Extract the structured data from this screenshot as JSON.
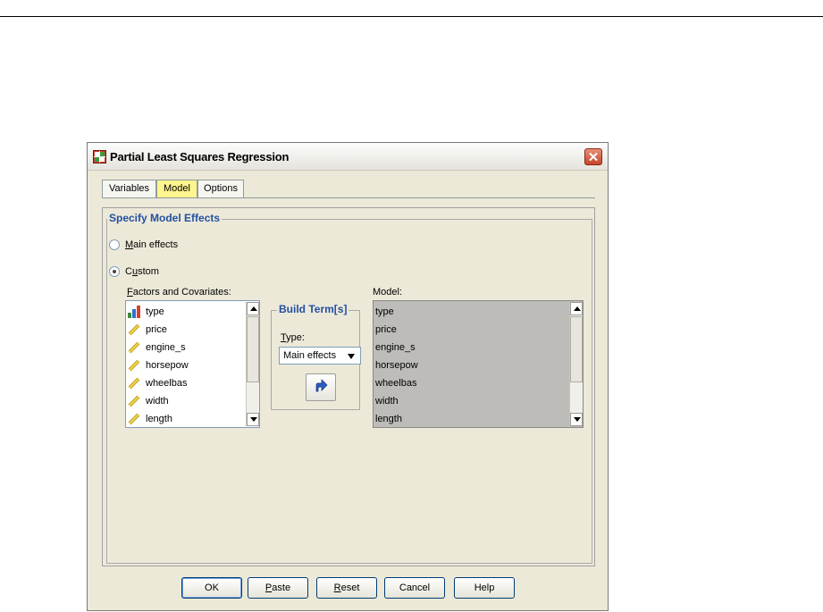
{
  "dialog": {
    "title": "Partial Least Squares Regression"
  },
  "tabs": [
    {
      "label": "Variables"
    },
    {
      "label": "Model"
    },
    {
      "label": "Options"
    }
  ],
  "model_effects": {
    "group_title": "Specify Model Effects",
    "main_effects_first": "M",
    "main_effects_rest": "ain effects",
    "custom_first": "C",
    "custom_underlined": "u",
    "custom_rest": "stom",
    "selected": "Custom"
  },
  "factors": {
    "label_first": "F",
    "label_rest": "actors and Covariates:",
    "items": [
      {
        "name": "type",
        "icon": "nominal-bar-icon"
      },
      {
        "name": "price",
        "icon": "scale-ruler-icon"
      },
      {
        "name": "engine_s",
        "icon": "scale-ruler-icon"
      },
      {
        "name": "horsepow",
        "icon": "scale-ruler-icon"
      },
      {
        "name": "wheelbas",
        "icon": "scale-ruler-icon"
      },
      {
        "name": "width",
        "icon": "scale-ruler-icon"
      },
      {
        "name": "length",
        "icon": "scale-ruler-icon"
      }
    ]
  },
  "build_term": {
    "title": "Build Term[s]",
    "type_first": "T",
    "type_rest": "ype:",
    "type_value": "Main effects"
  },
  "model": {
    "label": "Model:",
    "items": [
      "type",
      "price",
      "engine_s",
      "horsepow",
      "wheelbas",
      "width",
      "length"
    ]
  },
  "buttons": {
    "ok": "OK",
    "paste_first": "P",
    "paste_rest": "aste",
    "reset_first": "R",
    "reset_rest": "eset",
    "cancel": "Cancel",
    "help": "Help"
  },
  "colors": {
    "active_tab": "#fdf58d",
    "group_title": "#2450a2",
    "close_button": "#c6452a"
  }
}
